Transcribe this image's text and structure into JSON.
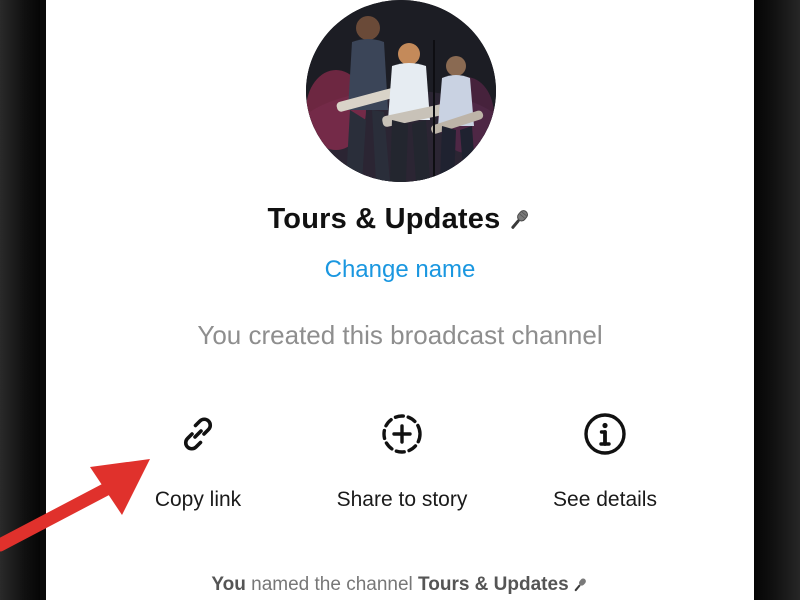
{
  "channel": {
    "title": "Tours & Updates",
    "change_name_label": "Change name",
    "created_note": "You created this broadcast channel"
  },
  "actions": [
    {
      "label": "Copy link",
      "icon": "link-icon"
    },
    {
      "label": "Share to story",
      "icon": "add-story-icon"
    },
    {
      "label": "See details",
      "icon": "info-icon"
    }
  ],
  "footer": {
    "actor": "You",
    "text": "named the channel",
    "channel_name": "Tours & Updates"
  },
  "colors": {
    "link_blue": "#1a97e0",
    "annotation_red": "#e0312c",
    "muted_text": "#8e8e8e"
  }
}
